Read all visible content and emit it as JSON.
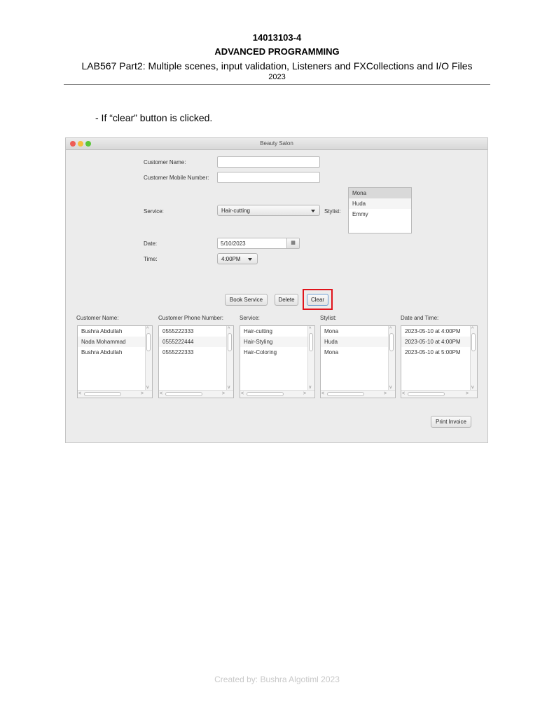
{
  "doc": {
    "course_code": "14013103-4",
    "course_name": "ADVANCED PROGRAMMING",
    "lab_title": "LAB567 Part2: Multiple scenes, input validation, Listeners and FXCollections and I/O Files",
    "year": "2023",
    "note": "- If “clear” button is clicked.",
    "footer": "Created by: Bushra Algotiml 2023"
  },
  "window": {
    "title": "Beauty Salon",
    "form": {
      "customer_name_label": "Customer Name:",
      "customer_name_value": "",
      "mobile_label": "Customer Mobile Number:",
      "mobile_value": "",
      "service_label": "Service:",
      "service_selected": "Hair-cutting",
      "stylist_label": "Stylist:",
      "stylists": [
        "Mona",
        "Huda",
        "Emmy"
      ],
      "stylist_selected": "Mona",
      "date_label": "Date:",
      "date_value": "5/10/2023",
      "time_label": "Time:",
      "time_selected": "4:00PM"
    },
    "buttons": {
      "book": "Book Service",
      "delete": "Delete",
      "clear": "Clear",
      "print": "Print Invoice"
    },
    "table": {
      "headers": [
        "Customer Name:",
        "Customer Phone Number:",
        "Service:",
        "Stylist:",
        "Date and Time:"
      ],
      "columns": [
        [
          "Bushra Abdullah",
          "Nada Mohammad",
          "Bushra Abdullah"
        ],
        [
          "0555222333",
          "0555222444",
          "0555222333"
        ],
        [
          "Hair-cutting",
          "Hair-Styling",
          "Hair-Coloring"
        ],
        [
          "Mona",
          "Huda",
          "Mona"
        ],
        [
          "2023-05-10 at 4:00PM",
          "2023-05-10 at 4:00PM",
          "2023-05-10 at 5:00PM"
        ]
      ]
    }
  },
  "colors": {
    "highlight": "#e0141c",
    "window_bg": "#ececec"
  }
}
